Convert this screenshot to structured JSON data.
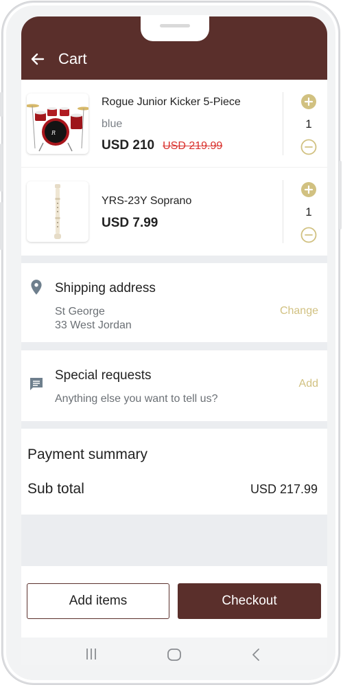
{
  "appbar": {
    "title": "Cart"
  },
  "cart": {
    "items": [
      {
        "name": "Rogue Junior Kicker 5-Piece",
        "variant": "blue",
        "price": "USD 210",
        "old_price": "USD 219.99",
        "quantity": "1",
        "image": "drum-kit"
      },
      {
        "name": "YRS-23Y Soprano",
        "variant": "",
        "price": "USD 7.99",
        "old_price": "",
        "quantity": "1",
        "image": "recorder"
      }
    ]
  },
  "shipping": {
    "title": "Shipping address",
    "line1": "St George",
    "line2": "33 West Jordan",
    "action": "Change"
  },
  "requests": {
    "title": "Special requests",
    "subtitle": "Anything else you want to tell us?",
    "action": "Add"
  },
  "payment": {
    "title": "Payment summary",
    "subtotal_label": "Sub total",
    "subtotal_value": "USD 217.99"
  },
  "actions": {
    "add_items": "Add items",
    "checkout": "Checkout"
  },
  "colors": {
    "brand": "#5a2f2b",
    "accent": "#d1c181",
    "strike": "#d9302c",
    "icon": "#6e7f8d"
  },
  "icons": [
    "back-arrow-icon",
    "plus-circle-icon",
    "minus-circle-icon",
    "location-pin-icon",
    "chat-icon",
    "recent-apps-icon",
    "home-icon",
    "nav-back-icon"
  ]
}
